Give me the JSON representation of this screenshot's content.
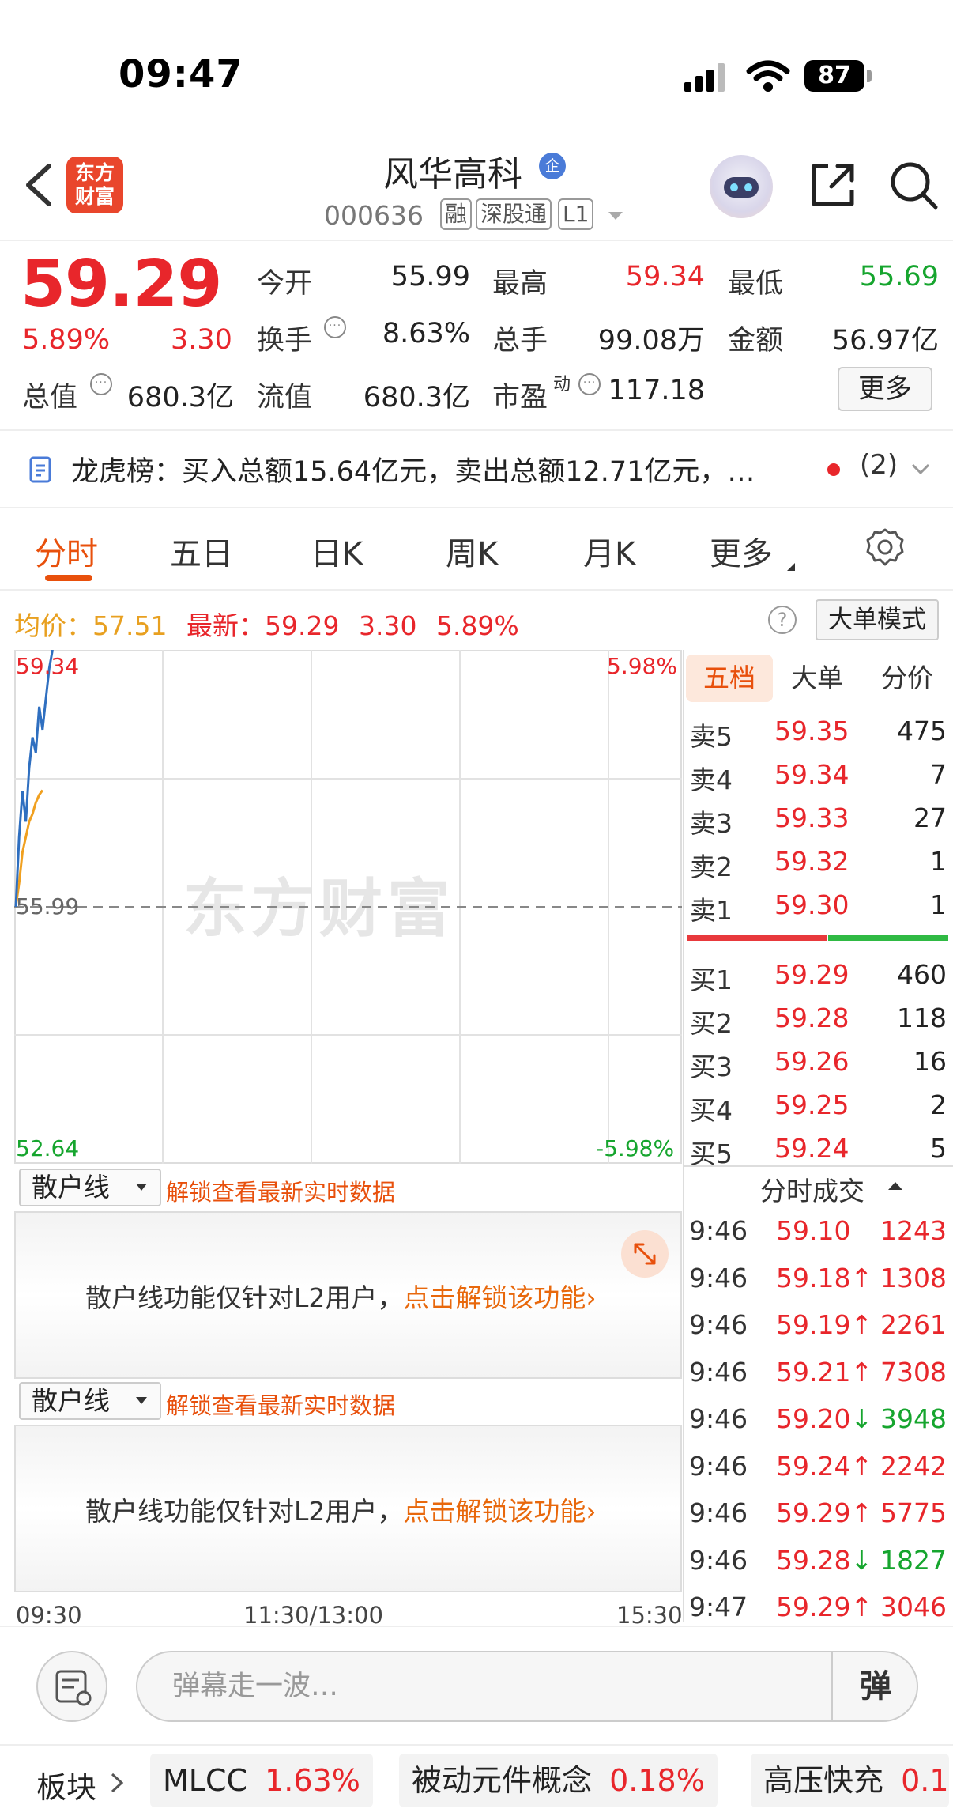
{
  "status": {
    "time": "09:47",
    "battery": "87"
  },
  "header": {
    "logo_line1": "东方",
    "logo_line2": "财富",
    "stock_name": "风华高科",
    "corp_badge": "企",
    "stock_code": "000636",
    "tags": [
      "融",
      "深股通",
      "L1"
    ]
  },
  "quote": {
    "price": "59.29",
    "change_pct": "5.89%",
    "change_amt": "3.30",
    "fields": {
      "open": {
        "label": "今开",
        "value": "55.99"
      },
      "high": {
        "label": "最高",
        "value": "59.34"
      },
      "low": {
        "label": "最低",
        "value": "55.69"
      },
      "turnover": {
        "label": "换手",
        "value": "8.63%"
      },
      "volume": {
        "label": "总手",
        "value": "99.08万"
      },
      "amount": {
        "label": "金额",
        "value": "56.97亿"
      },
      "total_cap": {
        "label": "总值",
        "value": "680.3亿"
      },
      "float_cap": {
        "label": "流值",
        "value": "680.3亿"
      },
      "pe": {
        "label": "市盈",
        "sup": "动",
        "value": "117.18"
      }
    },
    "more_label": "更多"
  },
  "lhb": {
    "text": "龙虎榜：买入总额15.64亿元，卖出总额12.71亿元，…",
    "count": "(2)"
  },
  "tabs": [
    "分时",
    "五日",
    "日K",
    "周K",
    "月K",
    "更多"
  ],
  "avg": {
    "avg_label": "均价：",
    "avg_value": "57.51",
    "latest_label": "最新：",
    "latest_price": "59.29",
    "latest_change": "3.30",
    "latest_pct": "5.89%"
  },
  "bigorder_label": "大单模式",
  "chart": {
    "y_top": "59.34",
    "y_mid": "55.99",
    "y_bottom": "52.64",
    "pct_top": "5.98%",
    "pct_bottom": "-5.98%",
    "watermark": "东方财富",
    "x_start": "09:30",
    "x_mid": "11:30/13:00",
    "x_end": "15:30",
    "colors": {
      "price_line": "#2f6fc0",
      "avg_line": "#f0a020"
    }
  },
  "chart_data": {
    "type": "line",
    "ylim": [
      52.64,
      59.34
    ],
    "baseline": 55.99,
    "x_ticks": [
      "09:30",
      "11:30/13:00",
      "15:30"
    ],
    "series": [
      {
        "values": [
          55.99,
          56.9,
          57.5,
          57.1,
          57.8,
          58.2,
          58.0,
          58.6,
          58.3,
          58.7,
          59.1,
          59.34
        ]
      },
      {
        "values": [
          55.99,
          56.3,
          56.7,
          56.9,
          57.1,
          57.2,
          57.35,
          57.45,
          57.51
        ]
      }
    ]
  },
  "orderbook": {
    "tabs": [
      "五档",
      "大单",
      "分价"
    ],
    "asks": [
      {
        "label": "卖5",
        "price": "59.35",
        "vol": "475"
      },
      {
        "label": "卖4",
        "price": "59.34",
        "vol": "7"
      },
      {
        "label": "卖3",
        "price": "59.33",
        "vol": "27"
      },
      {
        "label": "卖2",
        "price": "59.32",
        "vol": "1"
      },
      {
        "label": "卖1",
        "price": "59.30",
        "vol": "1"
      }
    ],
    "bids": [
      {
        "label": "买1",
        "price": "59.29",
        "vol": "460"
      },
      {
        "label": "买2",
        "price": "59.28",
        "vol": "118"
      },
      {
        "label": "买3",
        "price": "59.26",
        "vol": "16"
      },
      {
        "label": "买4",
        "price": "59.25",
        "vol": "2"
      },
      {
        "label": "买5",
        "price": "59.24",
        "vol": "5"
      }
    ]
  },
  "retail": {
    "select_label": "散户线",
    "unlock_text": "解锁查看最新实时数据",
    "msg_prefix": "散户线功能仅针对L2用户，",
    "msg_link": "点击解锁该功能"
  },
  "ticks": {
    "header": "分时成交",
    "rows": [
      {
        "time": "9:46",
        "price": "59.10",
        "arrow": "",
        "vol": "1243",
        "dir": "red"
      },
      {
        "time": "9:46",
        "price": "59.18↑",
        "arrow": "",
        "vol": "1308",
        "dir": "red"
      },
      {
        "time": "9:46",
        "price": "59.19↑",
        "arrow": "",
        "vol": "2261",
        "dir": "red"
      },
      {
        "time": "9:46",
        "price": "59.21↑",
        "arrow": "",
        "vol": "7308",
        "dir": "red"
      },
      {
        "time": "9:46",
        "price": "59.20↓",
        "arrow": "",
        "vol": "3948",
        "dir": "green"
      },
      {
        "time": "9:46",
        "price": "59.24↑",
        "arrow": "",
        "vol": "2242",
        "dir": "red"
      },
      {
        "time": "9:46",
        "price": "59.29↑",
        "arrow": "",
        "vol": "5775",
        "dir": "red"
      },
      {
        "time": "9:46",
        "price": "59.28↓",
        "arrow": "",
        "vol": "1827",
        "dir": "green"
      },
      {
        "time": "9:47",
        "price": "59.29↑",
        "arrow": "",
        "vol": "3046",
        "dir": "red"
      }
    ]
  },
  "comment": {
    "placeholder": "弹幕走一波…",
    "danmu": "弹"
  },
  "sectors": {
    "title": "板块",
    "items": [
      {
        "name": "MLCC",
        "pct": "1.63%"
      },
      {
        "name": "被动元件概念",
        "pct": "0.18%"
      },
      {
        "name": "高压快充",
        "pct": "0.1"
      }
    ]
  }
}
